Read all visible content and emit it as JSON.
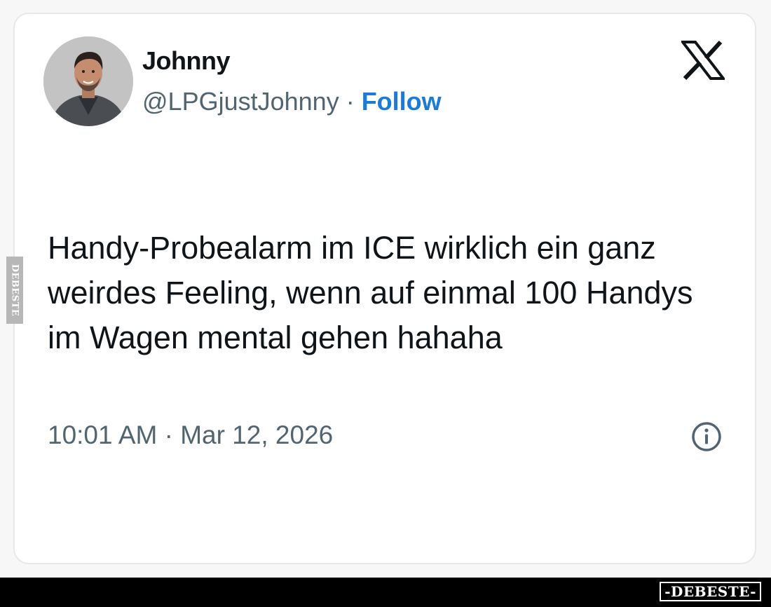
{
  "tweet": {
    "author_name": "Johnny",
    "handle": "@LPGjustJohnny",
    "separator": " · ",
    "follow_label": "Follow",
    "text": "Handy-Probealarm im ICE wirklich ein ganz weirdes Feeling, wenn auf einmal 100 Handys im Wagen mental gehen hahaha",
    "timestamp": "10:01 AM · Mar 12, 2026",
    "icons": {
      "brand": "x-logo-icon",
      "info": "info-icon",
      "avatar": "avatar"
    }
  },
  "watermark": {
    "side_text": "DEBESTE",
    "brand_badge": "-DEBESTE-"
  },
  "colors": {
    "text_primary": "#0f1419",
    "text_secondary": "#536471",
    "follow_link": "#1d7bd8",
    "card_border": "#e6e8eb",
    "bottom_bar": "#000000"
  }
}
